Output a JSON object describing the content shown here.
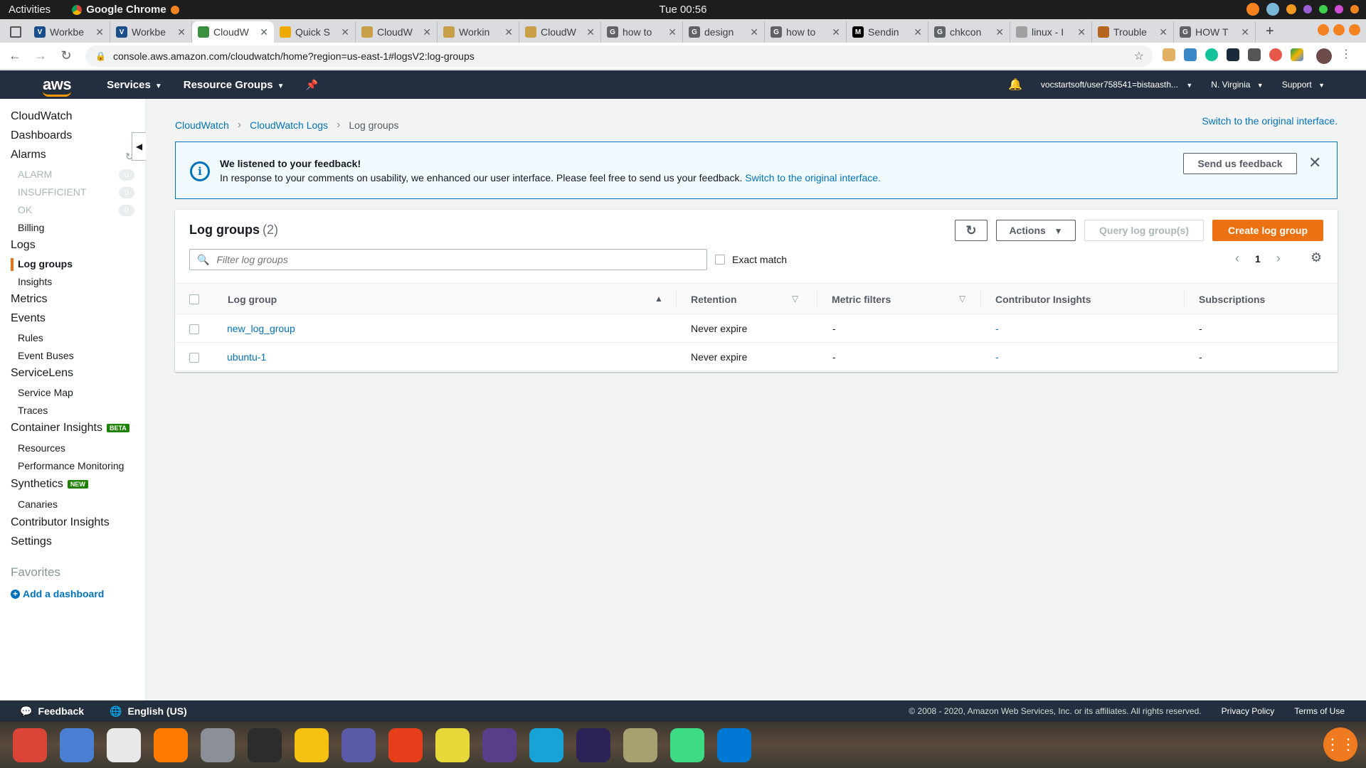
{
  "os": {
    "activities": "Activities",
    "app_name": "Google Chrome",
    "clock": "Tue 00:56"
  },
  "browser": {
    "tabs": [
      {
        "title": "Workbe",
        "icon": "vocareum-icon",
        "color": "#1a4e8a",
        "glyph": "V",
        "active": false
      },
      {
        "title": "Workbe",
        "icon": "vocareum-icon",
        "color": "#1a4e8a",
        "glyph": "V",
        "active": false
      },
      {
        "title": "CloudW",
        "icon": "cloudwatch-icon",
        "color": "#3b8f3e",
        "glyph": "",
        "active": true
      },
      {
        "title": "Quick S",
        "icon": "aws-box-icon",
        "color": "#f0a900",
        "glyph": "",
        "active": false
      },
      {
        "title": "CloudW",
        "icon": "aws-box-icon",
        "color": "#c9a049",
        "glyph": "",
        "active": false
      },
      {
        "title": "Workin",
        "icon": "aws-box-icon",
        "color": "#c9a049",
        "glyph": "",
        "active": false
      },
      {
        "title": "CloudW",
        "icon": "aws-box-icon",
        "color": "#c9a049",
        "glyph": "",
        "active": false
      },
      {
        "title": "how to",
        "icon": "google-icon",
        "color": "#5f6368",
        "glyph": "G",
        "active": false
      },
      {
        "title": "design",
        "icon": "google-icon",
        "color": "#5f6368",
        "glyph": "G",
        "active": false
      },
      {
        "title": "how to",
        "icon": "google-icon",
        "color": "#5f6368",
        "glyph": "G",
        "active": false
      },
      {
        "title": "Sendin",
        "icon": "medium-icon",
        "color": "#000000",
        "glyph": "M",
        "active": false
      },
      {
        "title": "chkcon",
        "icon": "google-icon",
        "color": "#5f6368",
        "glyph": "G",
        "active": false
      },
      {
        "title": "linux - I",
        "icon": "stackexchange-icon",
        "color": "#a0a0a0",
        "glyph": "",
        "active": false
      },
      {
        "title": "Trouble",
        "icon": "aws-box-icon",
        "color": "#b5651d",
        "glyph": "",
        "active": false
      },
      {
        "title": "HOW T",
        "icon": "google-icon",
        "color": "#5f6368",
        "glyph": "G",
        "active": false
      }
    ],
    "url": "console.aws.amazon.com/cloudwatch/home?region=us-east-1#logsV2:log-groups"
  },
  "aws_header": {
    "logo": "aws",
    "services": "Services",
    "resource_groups": "Resource Groups",
    "account": "vocstartsoft/user758541=bistaasth...",
    "region": "N. Virginia",
    "support": "Support"
  },
  "sidebar": {
    "cloudwatch": "CloudWatch",
    "dashboards": "Dashboards",
    "alarms": "Alarms",
    "alarm_states": [
      {
        "label": "ALARM",
        "count": "0"
      },
      {
        "label": "INSUFFICIENT",
        "count": "0"
      },
      {
        "label": "OK",
        "count": "0"
      }
    ],
    "billing": "Billing",
    "logs": "Logs",
    "log_groups": "Log groups",
    "insights": "Insights",
    "metrics": "Metrics",
    "events": "Events",
    "rules": "Rules",
    "event_buses": "Event Buses",
    "servicelens": "ServiceLens",
    "service_map": "Service Map",
    "traces": "Traces",
    "container_insights": "Container Insights",
    "beta_badge": "BETA",
    "resources": "Resources",
    "performance_monitoring": "Performance Monitoring",
    "synthetics": "Synthetics",
    "new_badge": "NEW",
    "canaries": "Canaries",
    "contributor_insights": "Contributor Insights",
    "settings": "Settings",
    "favorites": "Favorites",
    "add_dashboard": "Add a dashboard"
  },
  "breadcrumb": [
    "CloudWatch",
    "CloudWatch Logs",
    "Log groups"
  ],
  "switch_link": "Switch to the original interface.",
  "flash": {
    "title": "We listened to your feedback!",
    "body": "In response to your comments on usability, we enhanced our user interface. Please feel free to send us your feedback.",
    "link": "Switch to the original interface.",
    "feedback_button": "Send us feedback"
  },
  "log_groups": {
    "title": "Log groups",
    "count": "(2)",
    "actions": "Actions",
    "query": "Query log group(s)",
    "create": "Create log group",
    "search_placeholder": "Filter log groups",
    "exact_match": "Exact match",
    "page": "1",
    "columns": [
      "Log group",
      "Retention",
      "Metric filters",
      "Contributor Insights",
      "Subscriptions"
    ],
    "rows": [
      {
        "name": "new_log_group",
        "retention": "Never expire",
        "metric_filters": "-",
        "contributor": "-",
        "subscriptions": "-"
      },
      {
        "name": "ubuntu-1",
        "retention": "Never expire",
        "metric_filters": "-",
        "contributor": "-",
        "subscriptions": "-"
      }
    ]
  },
  "footer": {
    "feedback": "Feedback",
    "language": "English (US)",
    "copyright": "© 2008 - 2020, Amazon Web Services, Inc. or its affiliates. All rights reserved.",
    "privacy": "Privacy Policy",
    "terms": "Terms of Use"
  },
  "dock": [
    {
      "name": "chrome-icon",
      "color": "#db4437"
    },
    {
      "name": "chromium-icon",
      "color": "#4a7fd4"
    },
    {
      "name": "calendar-icon",
      "color": "#e8e8e8"
    },
    {
      "name": "firefox-icon",
      "color": "#ff7b00"
    },
    {
      "name": "files-icon",
      "color": "#8a8f98"
    },
    {
      "name": "terminal-icon",
      "color": "#2c2c2c"
    },
    {
      "name": "music-icon",
      "color": "#f5c211"
    },
    {
      "name": "document-icon",
      "color": "#5a5aa8"
    },
    {
      "name": "downloader-icon",
      "color": "#e63e1b"
    },
    {
      "name": "help-icon",
      "color": "#e8d83a"
    },
    {
      "name": "mail-icon",
      "color": "#5a3d8a"
    },
    {
      "name": "webcam-icon",
      "color": "#18a3d6"
    },
    {
      "name": "eclipse-icon",
      "color": "#2c2255"
    },
    {
      "name": "archive-icon",
      "color": "#a8a070"
    },
    {
      "name": "android-studio-icon",
      "color": "#3ddc84"
    },
    {
      "name": "vscode-icon",
      "color": "#0078d4"
    }
  ]
}
